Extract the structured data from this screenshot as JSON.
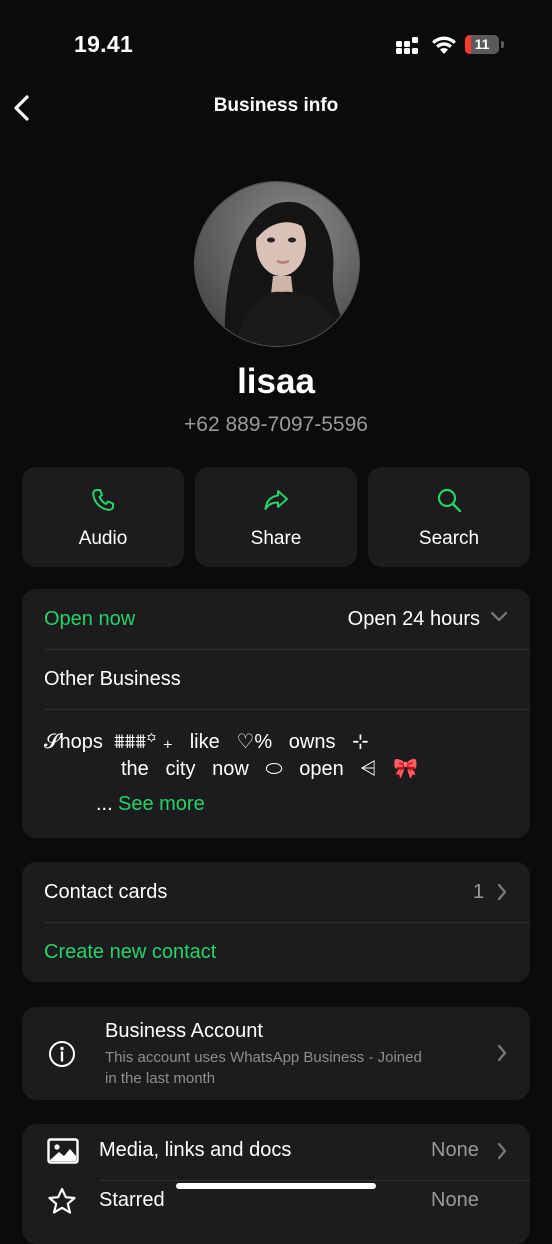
{
  "status_bar": {
    "time": "19.41",
    "battery_percent": "11",
    "battery_level": 0.11,
    "battery_color": "#ff3b30"
  },
  "nav": {
    "title": "Business info",
    "back_icon": "chevron-left-icon"
  },
  "profile": {
    "name": "lisaa",
    "phone": "+62 889-7097-5596"
  },
  "actions": [
    {
      "label": "Audio",
      "icon": "phone-icon"
    },
    {
      "label": "Share",
      "icon": "share-arrow-icon"
    },
    {
      "label": "Search",
      "icon": "search-icon"
    }
  ],
  "business_card": {
    "hours_status": "Open now",
    "hours_value": "Open 24 hours",
    "category": "Other Business",
    "description_line1": "𝓢hops  ⩩⩩⩩꙳ ₊   like   ♡%   owns   ⊹",
    "description_line2": "the   city   now   ⬭   open   ⩤   🎀",
    "ellipsis": "...",
    "see_more": "See more"
  },
  "contact_card": {
    "contact_cards_label": "Contact cards",
    "contact_cards_count": "1",
    "create_contact_label": "Create new contact"
  },
  "account_card": {
    "title": "Business Account",
    "subtitle_line1": "This account uses WhatsApp Business - Joined",
    "subtitle_line2": "in the last month",
    "icon": "info-icon"
  },
  "media_card": {
    "media_label": "Media, links and docs",
    "media_value": "None",
    "starred_label": "Starred",
    "starred_value": "None"
  },
  "colors": {
    "accent": "#25d366",
    "background": "#0b0b0b",
    "card": "#1c1c1e",
    "secondary_text": "#9a9a9a"
  }
}
